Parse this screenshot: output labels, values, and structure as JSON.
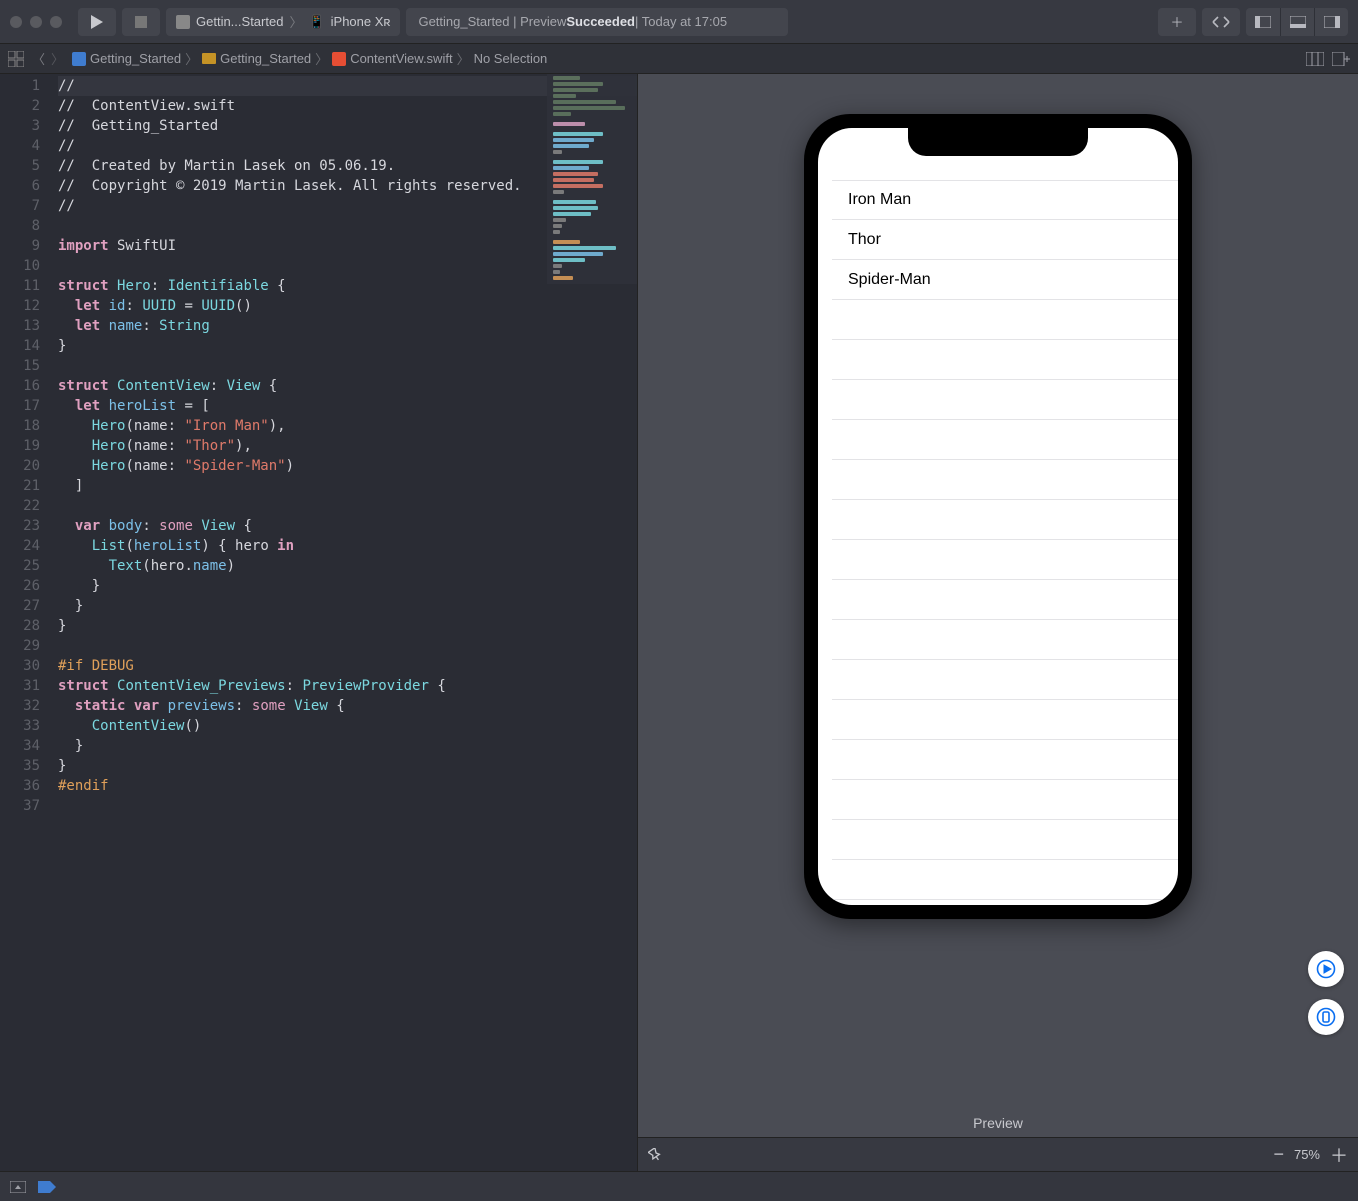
{
  "toolbar": {
    "scheme_target": "Gettin...Started",
    "scheme_device": "iPhone Xʀ",
    "status_prefix": "Getting_Started | Preview ",
    "status_result": "Succeeded",
    "status_suffix": " | Today at 17:05"
  },
  "jumpbar": {
    "crumbs": [
      "Getting_Started",
      "Getting_Started",
      "ContentView.swift",
      "No Selection"
    ]
  },
  "editor": {
    "lines": [
      {
        "n": 1,
        "hl": true,
        "seg": [
          {
            "c": "cmt",
            "t": "//"
          }
        ]
      },
      {
        "n": 2,
        "seg": [
          {
            "c": "cmt",
            "t": "//  ContentView.swift"
          }
        ]
      },
      {
        "n": 3,
        "seg": [
          {
            "c": "cmt",
            "t": "//  Getting_Started"
          }
        ]
      },
      {
        "n": 4,
        "seg": [
          {
            "c": "cmt",
            "t": "//"
          }
        ]
      },
      {
        "n": 5,
        "seg": [
          {
            "c": "cmt",
            "t": "//  Created by Martin Lasek on 05.06.19."
          }
        ]
      },
      {
        "n": 6,
        "seg": [
          {
            "c": "cmt",
            "t": "//  Copyright © 2019 Martin Lasek. All rights reserved."
          }
        ]
      },
      {
        "n": 7,
        "seg": [
          {
            "c": "cmt",
            "t": "//"
          }
        ]
      },
      {
        "n": 8,
        "seg": []
      },
      {
        "n": 9,
        "seg": [
          {
            "c": "kw",
            "t": "import"
          },
          {
            "c": "",
            "t": " SwiftUI"
          }
        ]
      },
      {
        "n": 10,
        "seg": []
      },
      {
        "n": 11,
        "seg": [
          {
            "c": "kw",
            "t": "struct"
          },
          {
            "c": "",
            "t": " "
          },
          {
            "c": "type",
            "t": "Hero"
          },
          {
            "c": "",
            "t": ": "
          },
          {
            "c": "type",
            "t": "Identifiable"
          },
          {
            "c": "",
            "t": " {"
          }
        ]
      },
      {
        "n": 12,
        "seg": [
          {
            "c": "",
            "t": "  "
          },
          {
            "c": "kw",
            "t": "let"
          },
          {
            "c": "",
            "t": " "
          },
          {
            "c": "ident",
            "t": "id"
          },
          {
            "c": "",
            "t": ": "
          },
          {
            "c": "type",
            "t": "UUID"
          },
          {
            "c": "",
            "t": " = "
          },
          {
            "c": "type",
            "t": "UUID"
          },
          {
            "c": "",
            "t": "()"
          }
        ]
      },
      {
        "n": 13,
        "seg": [
          {
            "c": "",
            "t": "  "
          },
          {
            "c": "kw",
            "t": "let"
          },
          {
            "c": "",
            "t": " "
          },
          {
            "c": "ident",
            "t": "name"
          },
          {
            "c": "",
            "t": ": "
          },
          {
            "c": "type",
            "t": "String"
          }
        ]
      },
      {
        "n": 14,
        "seg": [
          {
            "c": "",
            "t": "}"
          }
        ]
      },
      {
        "n": 15,
        "seg": []
      },
      {
        "n": 16,
        "seg": [
          {
            "c": "kw",
            "t": "struct"
          },
          {
            "c": "",
            "t": " "
          },
          {
            "c": "type",
            "t": "ContentView"
          },
          {
            "c": "",
            "t": ": "
          },
          {
            "c": "type",
            "t": "View"
          },
          {
            "c": "",
            "t": " {"
          }
        ]
      },
      {
        "n": 17,
        "seg": [
          {
            "c": "",
            "t": "  "
          },
          {
            "c": "kw",
            "t": "let"
          },
          {
            "c": "",
            "t": " "
          },
          {
            "c": "ident",
            "t": "heroList"
          },
          {
            "c": "",
            "t": " = ["
          }
        ]
      },
      {
        "n": 18,
        "seg": [
          {
            "c": "",
            "t": "    "
          },
          {
            "c": "type",
            "t": "Hero"
          },
          {
            "c": "",
            "t": "(name: "
          },
          {
            "c": "str",
            "t": "\"Iron Man\""
          },
          {
            "c": "",
            "t": "),"
          }
        ]
      },
      {
        "n": 19,
        "seg": [
          {
            "c": "",
            "t": "    "
          },
          {
            "c": "type",
            "t": "Hero"
          },
          {
            "c": "",
            "t": "(name: "
          },
          {
            "c": "str",
            "t": "\"Thor\""
          },
          {
            "c": "",
            "t": "),"
          }
        ]
      },
      {
        "n": 20,
        "seg": [
          {
            "c": "",
            "t": "    "
          },
          {
            "c": "type",
            "t": "Hero"
          },
          {
            "c": "",
            "t": "(name: "
          },
          {
            "c": "str",
            "t": "\"Spider-Man\""
          },
          {
            "c": "",
            "t": ")"
          }
        ]
      },
      {
        "n": 21,
        "seg": [
          {
            "c": "",
            "t": "  ]"
          }
        ]
      },
      {
        "n": 22,
        "seg": []
      },
      {
        "n": 23,
        "seg": [
          {
            "c": "",
            "t": "  "
          },
          {
            "c": "kw",
            "t": "var"
          },
          {
            "c": "",
            "t": " "
          },
          {
            "c": "ident",
            "t": "body"
          },
          {
            "c": "",
            "t": ": "
          },
          {
            "c": "kw2",
            "t": "some"
          },
          {
            "c": "",
            "t": " "
          },
          {
            "c": "type",
            "t": "View"
          },
          {
            "c": "",
            "t": " {"
          }
        ]
      },
      {
        "n": 24,
        "seg": [
          {
            "c": "",
            "t": "    "
          },
          {
            "c": "type",
            "t": "List"
          },
          {
            "c": "",
            "t": "("
          },
          {
            "c": "ident",
            "t": "heroList"
          },
          {
            "c": "",
            "t": ") { hero "
          },
          {
            "c": "kw",
            "t": "in"
          }
        ]
      },
      {
        "n": 25,
        "seg": [
          {
            "c": "",
            "t": "      "
          },
          {
            "c": "type",
            "t": "Text"
          },
          {
            "c": "",
            "t": "(hero."
          },
          {
            "c": "ident",
            "t": "name"
          },
          {
            "c": "",
            "t": ")"
          }
        ]
      },
      {
        "n": 26,
        "seg": [
          {
            "c": "",
            "t": "    }"
          }
        ]
      },
      {
        "n": 27,
        "seg": [
          {
            "c": "",
            "t": "  }"
          }
        ]
      },
      {
        "n": 28,
        "seg": [
          {
            "c": "",
            "t": "}"
          }
        ]
      },
      {
        "n": 29,
        "seg": []
      },
      {
        "n": 30,
        "seg": [
          {
            "c": "pp",
            "t": "#if DEBUG"
          }
        ]
      },
      {
        "n": 31,
        "seg": [
          {
            "c": "kw",
            "t": "struct"
          },
          {
            "c": "",
            "t": " "
          },
          {
            "c": "type",
            "t": "ContentView_Previews"
          },
          {
            "c": "",
            "t": ": "
          },
          {
            "c": "type",
            "t": "PreviewProvider"
          },
          {
            "c": "",
            "t": " {"
          }
        ]
      },
      {
        "n": 32,
        "seg": [
          {
            "c": "",
            "t": "  "
          },
          {
            "c": "kw",
            "t": "static"
          },
          {
            "c": "",
            "t": " "
          },
          {
            "c": "kw",
            "t": "var"
          },
          {
            "c": "",
            "t": " "
          },
          {
            "c": "ident",
            "t": "previews"
          },
          {
            "c": "",
            "t": ": "
          },
          {
            "c": "kw2",
            "t": "some"
          },
          {
            "c": "",
            "t": " "
          },
          {
            "c": "type",
            "t": "View"
          },
          {
            "c": "",
            "t": " {"
          }
        ]
      },
      {
        "n": 33,
        "seg": [
          {
            "c": "",
            "t": "    "
          },
          {
            "c": "type",
            "t": "ContentView"
          },
          {
            "c": "",
            "t": "()"
          }
        ]
      },
      {
        "n": 34,
        "seg": [
          {
            "c": "",
            "t": "  }"
          }
        ]
      },
      {
        "n": 35,
        "seg": [
          {
            "c": "",
            "t": "}"
          }
        ]
      },
      {
        "n": 36,
        "seg": [
          {
            "c": "pp",
            "t": "#endif"
          }
        ]
      },
      {
        "n": 37,
        "seg": []
      }
    ]
  },
  "preview": {
    "label": "Preview",
    "zoom": "75%",
    "list_items": [
      "Iron Man",
      "Thor",
      "Spider-Man"
    ],
    "empty_rows": 16
  }
}
